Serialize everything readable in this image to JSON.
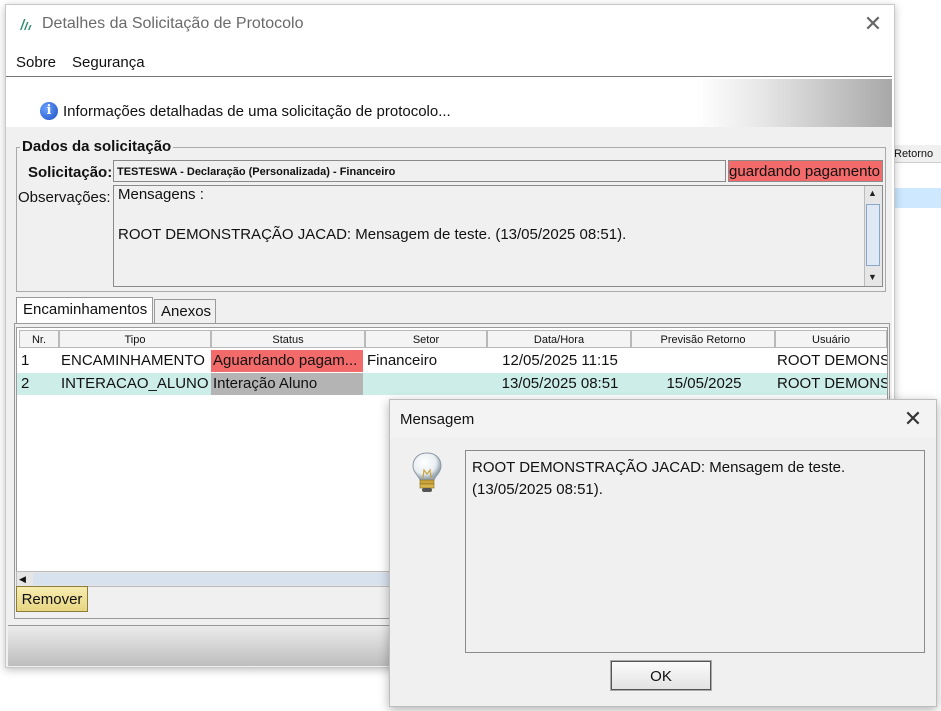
{
  "window": {
    "title": "Detalhes da Solicitação de Protocolo",
    "close_glyph": "✕"
  },
  "menu": {
    "items": [
      "Sobre",
      "Segurança"
    ]
  },
  "info_banner": {
    "text": "Informações detalhadas de uma solicitação de protocolo...",
    "icon": "info-icon"
  },
  "dados": {
    "legend": "Dados da solicitação",
    "solicitacao_label": "Solicitação:",
    "solicitacao_value": "TESTESWA - Declaração (Personalizada) - Financeiro",
    "status_value": "Aguardando pagamento",
    "observacoes_label": "Observações:",
    "observacoes_title": "Mensagens :",
    "observacoes_text": "ROOT DEMONSTRAÇÃO JACAD: Mensagem de teste. (13/05/2025 08:51)."
  },
  "tabs": [
    {
      "label": "Encaminhamentos",
      "active": true
    },
    {
      "label": "Anexos",
      "active": false
    }
  ],
  "table": {
    "headers": [
      "Nr.",
      "Tipo",
      "Status",
      "Setor",
      "Data/Hora",
      "Previsão Retorno",
      "Usuário"
    ],
    "rows": [
      {
        "nr": "1",
        "tipo": "ENCAMINHAMENTO",
        "status": "Aguardando pagam...",
        "setor": "Financeiro",
        "data_hora": "12/05/2025 11:15",
        "previsao": "",
        "usuario": "ROOT DEMONST"
      },
      {
        "nr": "2",
        "tipo": "INTERACAO_ALUNO",
        "status": "Interação Aluno",
        "setor": "",
        "data_hora": "13/05/2025 08:51",
        "previsao": "15/05/2025",
        "usuario": "ROOT DEMONST"
      }
    ]
  },
  "buttons": {
    "remover": "Remover"
  },
  "background": {
    "column_header": "Retorno"
  },
  "dialog": {
    "title": "Mensagem",
    "close_glyph": "✕",
    "message": "ROOT DEMONSTRAÇÃO JACAD: Mensagem de teste. (13/05/2025 08:51).",
    "ok_label": "OK",
    "icon": "lightbulb-icon"
  },
  "colors": {
    "status_red": "#f26a6a",
    "selected_row": "#cdeee8",
    "status_gray": "#b4b4b4",
    "remover_button": "#eede94"
  }
}
